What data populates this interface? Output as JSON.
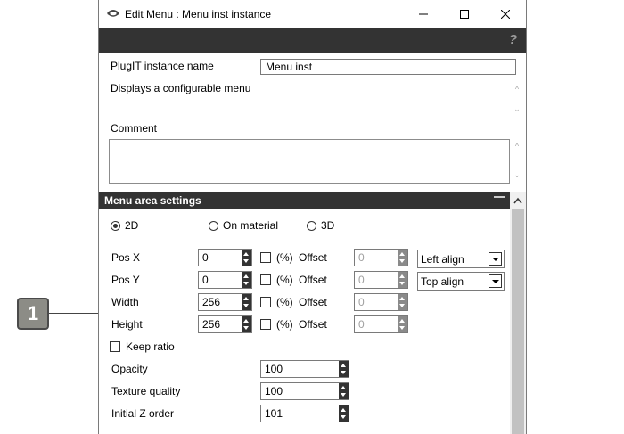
{
  "window": {
    "title": "Edit Menu : Menu inst instance"
  },
  "toolbar": {
    "help_icon": "question-icon"
  },
  "instance": {
    "name_label": "PlugIT instance name",
    "name_value": "Menu inst",
    "description": "Displays a configurable menu",
    "comment_label": "Comment",
    "comment_value": ""
  },
  "section": {
    "title": "Menu area settings",
    "collapse_symbol": "—"
  },
  "mode": {
    "options": [
      "2D",
      "On material",
      "3D"
    ],
    "selected": "2D"
  },
  "rows": [
    {
      "label": "Pos X",
      "value": "0",
      "percent": "(%)",
      "offset_label": "Offset",
      "offset_value": "0",
      "align": "Left align"
    },
    {
      "label": "Pos Y",
      "value": "0",
      "percent": "(%)",
      "offset_label": "Offset",
      "offset_value": "0",
      "align": "Top align"
    },
    {
      "label": "Width",
      "value": "256",
      "percent": "(%)",
      "offset_label": "Offset",
      "offset_value": "0"
    },
    {
      "label": "Height",
      "value": "256",
      "percent": "(%)",
      "offset_label": "Offset",
      "offset_value": "0"
    }
  ],
  "keep_ratio": {
    "label": "Keep ratio",
    "checked": false
  },
  "props": [
    {
      "label": "Opacity",
      "value": "100"
    },
    {
      "label": "Texture quality",
      "value": "100"
    },
    {
      "label": "Initial Z order",
      "value": "101"
    }
  ],
  "callout": {
    "number": "1"
  },
  "colors": {
    "dark_bar": "#333333",
    "callout_bg": "#8c8c86"
  }
}
